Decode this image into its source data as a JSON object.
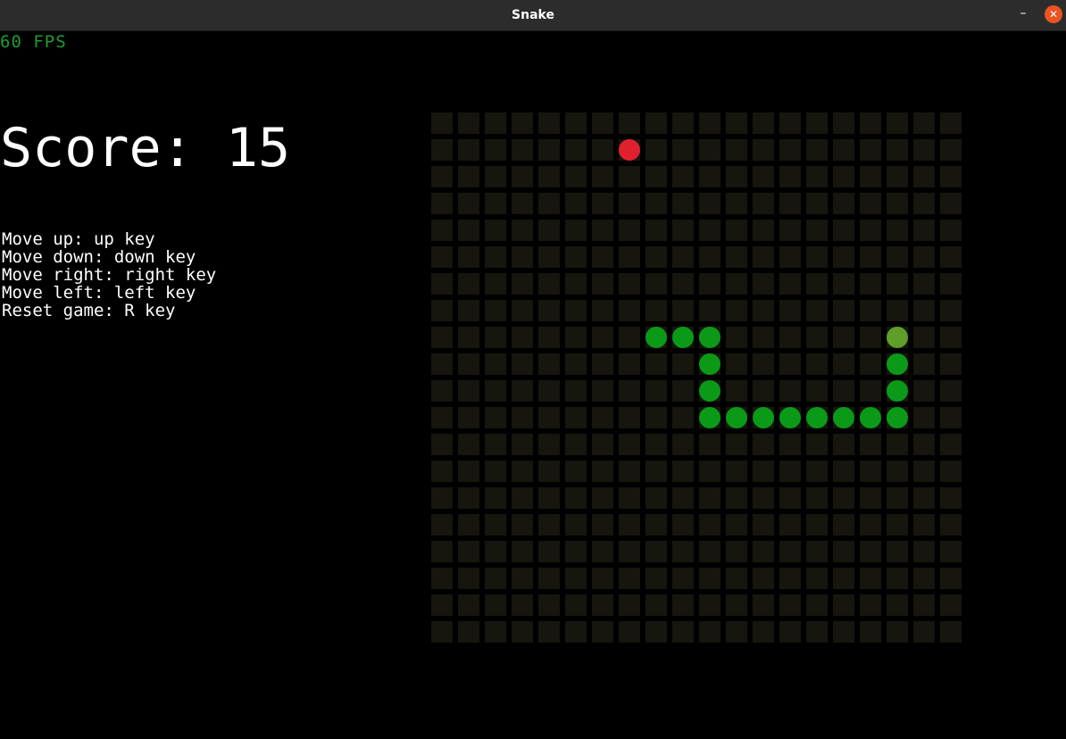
{
  "window": {
    "title": "Snake",
    "minimize_glyph": "–",
    "close_glyph": "✕"
  },
  "hud": {
    "fps_text": "60 FPS",
    "score_text": "Score: 15",
    "controls": [
      "Move up: up key",
      "Move down: down key",
      "Move right: right key",
      "Move left: left key",
      "Reset game: R key"
    ]
  },
  "board": {
    "cols": 20,
    "rows": 20,
    "food": {
      "col": 7,
      "row": 1
    },
    "snake_head": {
      "col": 17,
      "row": 8
    },
    "snake_body": [
      {
        "col": 17,
        "row": 9
      },
      {
        "col": 17,
        "row": 10
      },
      {
        "col": 17,
        "row": 11
      },
      {
        "col": 16,
        "row": 11
      },
      {
        "col": 15,
        "row": 11
      },
      {
        "col": 14,
        "row": 11
      },
      {
        "col": 13,
        "row": 11
      },
      {
        "col": 12,
        "row": 11
      },
      {
        "col": 11,
        "row": 11
      },
      {
        "col": 10,
        "row": 11
      },
      {
        "col": 10,
        "row": 10
      },
      {
        "col": 10,
        "row": 9
      },
      {
        "col": 10,
        "row": 8
      },
      {
        "col": 9,
        "row": 8
      },
      {
        "col": 8,
        "row": 8
      }
    ]
  },
  "colors": {
    "titlebar_bg": "#2c2c2c",
    "close_button": "#e95420",
    "fps_text": "#1f9d2f",
    "cell": "#16160f",
    "food": "#e0202e",
    "snake_head": "#5f9e28",
    "snake_body": "#0a9a17"
  }
}
